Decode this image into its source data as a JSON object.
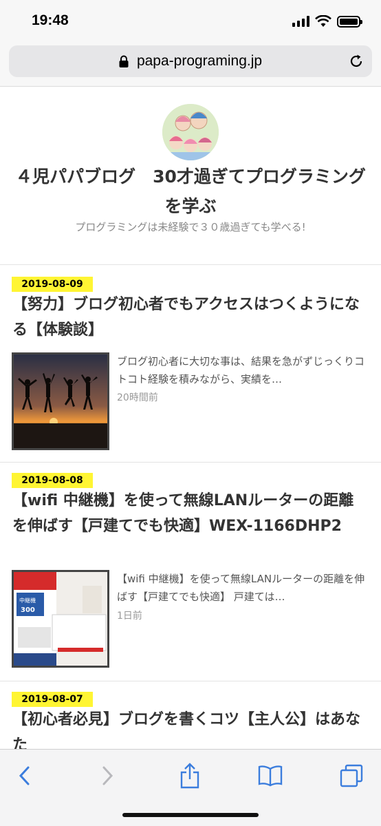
{
  "status": {
    "time": "19:48"
  },
  "browser": {
    "url": "papa-programing.jp"
  },
  "site": {
    "title": "４児パパブログ　30才過ぎてプログラミングを学ぶ",
    "description": "プログラミングは未経験で３０歳過ぎても学べる!"
  },
  "articles": [
    {
      "date": "2019-08-09",
      "title": "【努力】ブログ初心者でもアクセスはつくようになる【体験談】",
      "excerpt": "ブログ初心者に大切な事は、結果を急がずじっくりコトコト経験を積みながら、実績を…",
      "time_ago": "20時間前"
    },
    {
      "date": "2019-08-08",
      "title": "【wifi 中継機】を使って無線LANルーターの距離を伸ばす【戸建てでも快適】WEX-1166DHP2",
      "excerpt": "【wifi 中継機】を使って無線LANルーターの距離を伸ばす【戸建てでも快適】 戸建ては…",
      "time_ago": "1日前"
    },
    {
      "date": "2019-08-07",
      "title": "【初心者必見】ブログを書くコツ【主人公】はあなた"
    }
  ],
  "colors": {
    "date_badge": "#fff533",
    "toolbar_accent": "#3b7ddd"
  }
}
